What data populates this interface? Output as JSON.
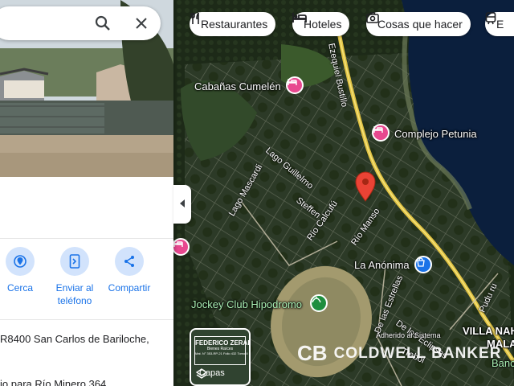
{
  "search": {
    "search_icon": "search-icon",
    "close_icon": "close-icon"
  },
  "place_panel": {
    "actions": [
      {
        "label": "Cerca",
        "icon": "nearby-icon"
      },
      {
        "label": "Enviar al teléfono",
        "label_line1": "Enviar al",
        "label_line2": "teléfono",
        "icon": "send-to-phone-icon"
      },
      {
        "label": "Compartir",
        "icon": "share-icon"
      }
    ],
    "address": "R8400 San Carlos de Bariloche,",
    "plus_code_line": "io para Río Minero 364"
  },
  "category_chips": [
    {
      "label": "Restaurantes",
      "icon": "restaurant-icon"
    },
    {
      "label": "Hoteles",
      "icon": "hotel-icon"
    },
    {
      "label": "Cosas que hacer",
      "icon": "camera-icon"
    },
    {
      "label": "E",
      "icon": "transit-icon"
    }
  ],
  "map": {
    "places": [
      {
        "name": "Cabañas Cumelén",
        "icon": "hotel-pin-icon"
      },
      {
        "name": "Complejo Petunia",
        "icon": "hotel-pin-icon"
      },
      {
        "name": "La Anónima",
        "icon": "shopping-pin-icon"
      },
      {
        "name": "Jockey Club Hipodromo",
        "icon": "park-pin-icon"
      }
    ],
    "roads": {
      "ezequiel_bustillo": "Ezequiel Bustillo",
      "lago_guillelmo": "Lago Guillelmo",
      "lago_mascardi": "Lago Mascardi",
      "steffen": "Steffen",
      "rio_calcufu": "Río Calcufú",
      "rio_manso": "Río Manso",
      "de_las_estrellas": "De las Estrellas",
      "de_los_eclipses": "De los Eclipses",
      "adherido": "Adherido al Sistema",
      "pudu": "Pudu ru",
      "trebol": "Trebol",
      "villa_nah": "VILLA NAH",
      "mala": "MALA",
      "banca": "Banca"
    },
    "layers_label": "Capas",
    "watermark": "COLDWELL BANKER",
    "watermark_logo": "CB",
    "ad_title": "FEDERICO ZERAR",
    "ad_sub": "Bienes Raíces",
    "ad_license": "Mat. N° 353-RP-21 Folio 432 Tomo II",
    "colors": {
      "lake": "#0b1f3d",
      "road": "#e0c243",
      "selected_pin": "#ea4335",
      "hotel_pin": "#e8488f",
      "shop_pin": "#1a73e8",
      "park_pin": "#1e8e3e"
    }
  }
}
